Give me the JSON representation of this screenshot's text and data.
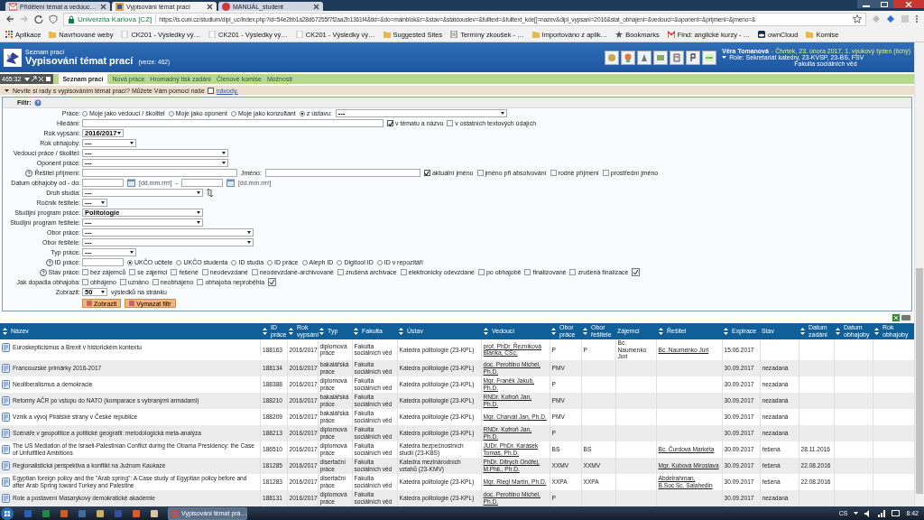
{
  "browser": {
    "tabs": [
      {
        "title": "Přidělení témat a vedouc…",
        "selected": false,
        "kind": "mail"
      },
      {
        "title": "Vypisování témat prací",
        "selected": true,
        "kind": "app"
      },
      {
        "title": "MANUÁL_student",
        "selected": false,
        "kind": "pdf"
      }
    ],
    "secure_label": "Univerzita Karlova [CZ]",
    "url": "https://is.cuni.cz/studium/dipl_uc/index.php?id=54e2bb1a28d67255f7f2aa2b1361f4&tid=&do=mainblok&r=&stav=&statdouslev=&fulltext=&fulltext_kde[]=nazev&dipl_vypsani=2016&stat_obhajeni=&vedouci=&oponent=&prijmeni=&jmeno=&",
    "bookmarks": [
      {
        "label": "Aplikace",
        "kind": "apps"
      },
      {
        "label": "Navrhované weby",
        "kind": "folder"
      },
      {
        "label": "CK201 - Výsledky vý…",
        "kind": "page"
      },
      {
        "label": "CK201 - Výsledky vý…",
        "kind": "page"
      },
      {
        "label": "CK201 - Výsledky vý…",
        "kind": "page"
      },
      {
        "label": "Suggested Sites",
        "kind": "folder"
      },
      {
        "label": "Termíny zkoušek - …",
        "kind": "doc"
      },
      {
        "label": "Importováno z aplik…",
        "kind": "folder"
      },
      {
        "label": "Bookmarks",
        "kind": "star"
      },
      {
        "label": "Find: anglické kurzy - …",
        "kind": "mail"
      },
      {
        "label": "ownCloud",
        "kind": "cloud"
      },
      {
        "label": "Komise",
        "kind": "folder"
      }
    ]
  },
  "header": {
    "subtitle": "Seznam prací",
    "title": "Vypisování témat prací",
    "version": "(verze: 462)",
    "user": "Věra Tomanová",
    "date": "- Čtvrtek, 23. února 2017, 1. výukový týden (lichý)",
    "role": "Role: Sekretariát katedry, 23-KVSP, 23-BS, FSV",
    "faculty": "Fakulta sociálních věd"
  },
  "menu": {
    "counter": "465:32",
    "tabs": [
      {
        "label": "Seznam prací",
        "selected": true
      }
    ],
    "links": [
      "Nová práce",
      "Hromadný tisk zadání",
      "Členové komise",
      "Možnosti"
    ]
  },
  "info": {
    "text": "Nevíte si rady s vypisováním témat prací? Můžete Vám pomoci naše",
    "link": "návody."
  },
  "filter": {
    "title": "Filtr:",
    "rows": [
      {
        "label": "Práce:",
        "controls": [
          {
            "kind": "radio",
            "label": "Moje jako vedoucí / školitel",
            "selected": false
          },
          {
            "kind": "radio",
            "label": "Moje jako oponent",
            "selected": false
          },
          {
            "kind": "radio",
            "label": "Moje jako konzultant",
            "selected": false
          },
          {
            "kind": "radio",
            "label": "z ústavu:",
            "selected": true
          },
          {
            "kind": "wide-select",
            "value": "---"
          }
        ]
      },
      {
        "label": "Hledání:",
        "controls": [
          {
            "kind": "long-input"
          },
          {
            "kind": "checkbox",
            "label": "v tématu a názvu",
            "checked": true
          },
          {
            "kind": "checkbox",
            "label": "v ostatních textových údajích",
            "checked": false
          }
        ]
      },
      {
        "label": "Rok vypsání:",
        "controls": [
          {
            "kind": "short-select",
            "value": "2016/2017"
          }
        ]
      },
      {
        "label": "Rok obhajoby:",
        "controls": [
          {
            "kind": "select",
            "value": "---"
          }
        ]
      },
      {
        "label": "Vedoucí práce / školitel:",
        "controls": [
          {
            "kind": "long-select",
            "value": "---"
          }
        ]
      },
      {
        "label": "Oponent práce:",
        "controls": [
          {
            "kind": "long-select",
            "value": "---"
          }
        ]
      },
      {
        "label": "Řešitel příjmení:",
        "help": true,
        "controls": [
          {
            "kind": "input"
          },
          {
            "kind": "text",
            "text": "Jméno:"
          },
          {
            "kind": "input"
          },
          {
            "kind": "checkbox",
            "label": "aktuální jméno",
            "checked": true
          },
          {
            "kind": "checkbox",
            "label": "jméno při absolvování",
            "checked": false
          },
          {
            "kind": "checkbox",
            "label": "rodné příjmení",
            "checked": false
          },
          {
            "kind": "checkbox",
            "label": "prostřední jméno",
            "checked": false
          }
        ]
      },
      {
        "label": "Datum obhajoby od - do:",
        "controls": [
          {
            "kind": "date",
            "hint": "[dd.mm.rrrr]"
          },
          {
            "kind": "text",
            "text": "-"
          },
          {
            "kind": "date",
            "hint": "[dd.mm.rrrr]"
          }
        ]
      },
      {
        "label": "Druh studia:",
        "controls": [
          {
            "kind": "medium-select",
            "value": "---"
          },
          {
            "kind": "swap"
          }
        ]
      },
      {
        "label": "Ročník řešitele:",
        "controls": [
          {
            "kind": "tiny-select",
            "value": "---"
          }
        ]
      },
      {
        "label": "Studijní program práce:",
        "controls": [
          {
            "kind": "medium-select",
            "value": "Politologie"
          }
        ]
      },
      {
        "label": "Studijní program řešitele:",
        "controls": [
          {
            "kind": "medium-select",
            "value": "---"
          }
        ]
      },
      {
        "label": "Obor práce:",
        "controls": [
          {
            "kind": "wide-select",
            "value": "---"
          }
        ]
      },
      {
        "label": "Obor řešitele:",
        "controls": [
          {
            "kind": "wide-select",
            "value": "---"
          }
        ]
      },
      {
        "label": "Typ práce:",
        "controls": [
          {
            "kind": "select",
            "value": "---"
          }
        ]
      },
      {
        "label": "ID práce:",
        "help": true,
        "controls": [
          {
            "kind": "short-input"
          },
          {
            "kind": "radio",
            "label": "UKČO učitele",
            "selected": true
          },
          {
            "kind": "radio",
            "label": "UKČO studenta",
            "selected": false
          },
          {
            "kind": "radio",
            "label": "ID studia",
            "selected": false
          },
          {
            "kind": "radio",
            "label": "ID práce",
            "selected": false
          },
          {
            "kind": "radio",
            "label": "Aleph ID",
            "selected": false
          },
          {
            "kind": "radio",
            "label": "Digitool ID",
            "selected": false
          },
          {
            "kind": "radio",
            "label": "ID v repozitáři",
            "selected": false
          }
        ]
      },
      {
        "label": "Stav práce:",
        "help": true,
        "controls": [
          {
            "kind": "checkbox",
            "label": "bez zájemců",
            "checked": false
          },
          {
            "kind": "checkbox",
            "label": "se zájemci",
            "checked": false
          },
          {
            "kind": "checkbox",
            "label": "řešené",
            "checked": false
          },
          {
            "kind": "checkbox",
            "label": "neodevzdané",
            "checked": false
          },
          {
            "kind": "checkbox",
            "label": "neodevzdané-archivované",
            "checked": false
          },
          {
            "kind": "checkbox",
            "label": "zrušená archivace",
            "checked": false
          },
          {
            "kind": "checkbox",
            "label": "elektronicky odevzdané",
            "checked": false
          },
          {
            "kind": "checkbox",
            "label": "po obhajobě",
            "checked": false
          },
          {
            "kind": "checkbox",
            "label": "finalizované",
            "checked": false
          },
          {
            "kind": "checkbox",
            "label": "zrušená finalizace",
            "checked": false
          },
          {
            "kind": "invert"
          }
        ]
      },
      {
        "label": "Jak dopadla obhajoba:",
        "controls": [
          {
            "kind": "checkbox",
            "label": "obhájeno",
            "checked": false
          },
          {
            "kind": "checkbox",
            "label": "uznáno",
            "checked": false
          },
          {
            "kind": "checkbox",
            "label": "neobhájeno",
            "checked": false
          },
          {
            "kind": "checkbox",
            "label": "obhajoba neproběhla",
            "checked": false
          },
          {
            "kind": "invert"
          }
        ]
      },
      {
        "label": "Zobrazit:",
        "controls": [
          {
            "kind": "tiny-select",
            "value": "50"
          },
          {
            "kind": "text",
            "text": "výsledků na stránku"
          }
        ]
      },
      {
        "controls": [
          {
            "kind": "button",
            "label": "Zobrazit"
          },
          {
            "kind": "button",
            "label": "Vymazat filtr"
          }
        ]
      }
    ]
  },
  "table": {
    "columns": [
      {
        "label": "Název",
        "sortable": true,
        "kind": "title"
      },
      {
        "label": "ID práce",
        "sortable": true,
        "kind": "text"
      },
      {
        "label": "Rok vypsání",
        "sortable": true,
        "kind": "text"
      },
      {
        "label": "Typ",
        "sortable": true,
        "kind": "text"
      },
      {
        "label": "Fakulta",
        "sortable": true,
        "kind": "text"
      },
      {
        "label": "Ústav",
        "sortable": true,
        "kind": "text"
      },
      {
        "label": "Vedoucí",
        "sortable": true,
        "kind": "link"
      },
      {
        "label": "Obor práce",
        "sortable": true,
        "kind": "text"
      },
      {
        "label": "Obor řešitele",
        "sortable": true,
        "kind": "text"
      },
      {
        "label": "Zájemci",
        "sortable": false,
        "kind": "text"
      },
      {
        "label": "Řešitel",
        "sortable": true,
        "kind": "link"
      },
      {
        "label": "Expirace",
        "sortable": true,
        "kind": "text"
      },
      {
        "label": "Stav",
        "sortable": false,
        "kind": "text"
      },
      {
        "label": "Datum zadání",
        "sortable": true,
        "kind": "text"
      },
      {
        "label": "Datum obhajoby",
        "sortable": true,
        "kind": "text"
      },
      {
        "label": "Rok obhajoby",
        "sortable": true,
        "kind": "text"
      }
    ],
    "rows": [
      {
        "title": "Euroskepticismus a Brexit v historickém kontextu",
        "id": "188163",
        "year": "2016/2017",
        "type": "diplomová práce",
        "faculty": "Fakulta sociálních věd",
        "department": "Katedra politologie (23-KPL)",
        "supervisor": "prof. PhDr. Řezníková Blanka, CSc.",
        "field": "P",
        "student_field": "P",
        "applicants": "Bc. Naumenko Juri",
        "student": "Bc. Naumenko Juri",
        "expiry": "15.06.2017"
      },
      {
        "title": "Francouzské primárky 2016-2017",
        "id": "188134",
        "year": "2016/2017",
        "type": "bakalářská práce",
        "faculty": "Fakulta sociálních věd",
        "department": "Katedra politologie (23-KPL)",
        "supervisor": "doc. Perottino Michel, Ph.D.",
        "field": "PMV",
        "expiry": "30.09.2017",
        "state": "nezadaná"
      },
      {
        "title": "Neoliberalismus a demokracie",
        "id": "188388",
        "year": "2016/2017",
        "type": "diplomová práce",
        "faculty": "Fakulta sociálních věd",
        "department": "Katedra politologie (23-KPL)",
        "supervisor": "Mgr. Franěk Jakub, Ph.D.",
        "field": "P",
        "expiry": "30.09.2017",
        "state": "nezadaná"
      },
      {
        "title": "Reformy AČR po vstupu do NATO (komparace s vybranými armádami)",
        "id": "188210",
        "year": "2016/2017",
        "type": "bakalářská práce",
        "faculty": "Fakulta sociálních věd",
        "department": "Katedra politologie (23-KPL)",
        "supervisor": "RNDr. Kofroň Jan, Ph.D.",
        "field": "PMV",
        "expiry": "30.09.2017",
        "state": "nezadaná"
      },
      {
        "title": "Vznik a vývoj Pirátské strany v České republice",
        "id": "188209",
        "year": "2016/2017",
        "type": "bakalářská práce",
        "faculty": "Fakulta sociálních věd",
        "department": "Katedra politologie (23-KPL)",
        "supervisor": "Mgr. Charvát Jan, Ph.D.",
        "field": "PMV",
        "expiry": "30.09.2017",
        "state": "nezadaná"
      },
      {
        "title": "Scénáře v geopolitice a politické geografii: metodologická meta-analýza",
        "id": "188213",
        "year": "2016/2017",
        "type": "diplomová práce",
        "faculty": "Fakulta sociálních věd",
        "department": "Katedra politologie (23-KPL)",
        "supervisor": "RNDr. Kofroň Jan, Ph.D.",
        "field": "P",
        "expiry": "30.09.2017",
        "state": "nezadaná"
      },
      {
        "title": "The US Mediation of the Israeli-Palestinian Conflict during the Obama Presidency: the Case of Unfulfilled Ambitions",
        "id": "186510",
        "year": "2016/2017",
        "type": "diplomová práce",
        "faculty": "Fakulta sociálních věd",
        "department": "Katedra bezpečnostních studií (23-KBS)",
        "supervisor": "JUDr. PhDr. Karásek Tomáš, Ph.D.",
        "field": "BS",
        "student_field": "BS",
        "student": "Bc. Čurdová Markéta",
        "expiry": "30.09.2017",
        "state": "řešená",
        "assigned": "28.11.2016"
      },
      {
        "title": "Regionalistická perspektiva a konflikt na Južnom Kaukaze",
        "id": "181285",
        "year": "2016/2017",
        "type": "disertační práce",
        "faculty": "Fakulta sociálních věd",
        "department": "Katedra mezinárodních vztahů (23-KMV)",
        "supervisor": "PhDr. Ditrych Ondřej, M.Phil., Ph.D.",
        "field": "XXMV",
        "student_field": "XXMV",
        "student": "Mgr. Kubová Miroslava",
        "expiry": "30.09.2017",
        "state": "řešená",
        "assigned": "22.08.2016"
      },
      {
        "title": "Egyptian foreign policy and the \"Arab spring\": A Case study of Egyptian policy before and after Arab Spring toward Turkey and Palestine",
        "id": "181283",
        "year": "2016/2017",
        "type": "disertační práce",
        "faculty": "Fakulta sociálních věd",
        "department": "Katedra politologie (23-KPL)",
        "supervisor": "Mgr. Riegl Martin, Ph.D.",
        "field": "XXPA",
        "student_field": "XXPA",
        "student": "Abdelrahman, B.Soc.Sc. Salahedin",
        "expiry": "30.09.2017",
        "state": "řešená",
        "assigned": "22.08.2016"
      },
      {
        "title": "Role a postavení Masarykovy demokratické akademie",
        "id": "188131",
        "year": "2016/2017",
        "type": "diplomová práce",
        "faculty": "Fakulta sociálních věd",
        "department": "Katedra politologie (23-KPL)",
        "supervisor": "doc. Perottino Michel, Ph.D.",
        "field": "P",
        "expiry": "30.09.2017",
        "state": "nezadaná"
      }
    ]
  },
  "taskbar": {
    "windows": [
      {
        "title": "Vypisování témat prá…",
        "selected": true
      }
    ],
    "language": "CS",
    "time": "8:42"
  }
}
